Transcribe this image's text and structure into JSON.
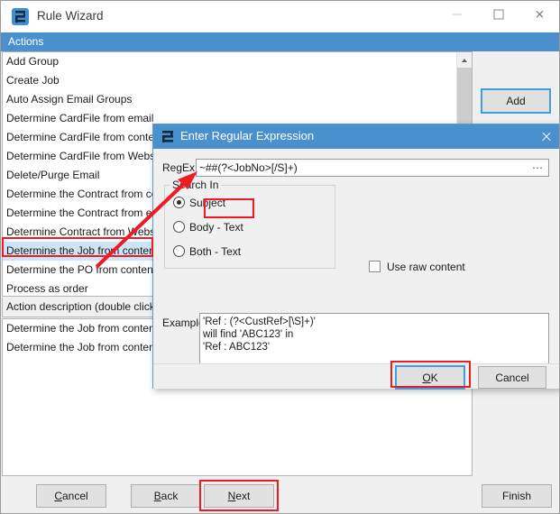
{
  "window": {
    "title": "Rule Wizard",
    "icon": "app-icon",
    "controls": {
      "minimize": "minimize-icon",
      "maximize": "maximize-icon",
      "close": "close-icon"
    }
  },
  "actions_header": {
    "label": "Actions"
  },
  "actions_list": {
    "items": [
      {
        "label": "Add Group",
        "selected": false
      },
      {
        "label": "Create Job",
        "selected": false
      },
      {
        "label": "Auto Assign Email Groups",
        "selected": false
      },
      {
        "label": "Determine CardFile from email",
        "selected": false
      },
      {
        "label": "Determine CardFile from contents",
        "selected": false
      },
      {
        "label": "Determine CardFile from Website",
        "selected": false
      },
      {
        "label": "Delete/Purge Email",
        "selected": false
      },
      {
        "label": "Determine the Contract from contents",
        "selected": false
      },
      {
        "label": "Determine the Contract from email",
        "selected": false
      },
      {
        "label": "Determine Contract from Website",
        "selected": false
      },
      {
        "label": "Determine the Job from contents",
        "selected": true
      },
      {
        "label": "Determine the PO from contents",
        "selected": false
      },
      {
        "label": "Process as order",
        "selected": false
      }
    ]
  },
  "description_section": {
    "header": "Action description (double click to edit)",
    "items": [
      {
        "label": "Determine the Job from contents"
      },
      {
        "label": "Determine the Job from contents"
      }
    ]
  },
  "right_panel": {
    "add_label": "Add"
  },
  "wizard_buttons": {
    "cancel": "Cancel",
    "cancel_accel": "C",
    "back": "Back",
    "back_accel": "B",
    "next": "Next",
    "next_accel": "N",
    "finish": "Finish"
  },
  "dialog": {
    "title": "Enter Regular Expression",
    "icon": "app-icon",
    "close_icon": "close-icon",
    "regex": {
      "label": "RegEx",
      "value": "~##(?<JobNo>[/S]+)",
      "placeholder": "",
      "browse_glyph": "⋯"
    },
    "search_in": {
      "title": "Search In",
      "options": [
        {
          "label": "Subject",
          "checked": true
        },
        {
          "label": "Body - Text",
          "checked": false
        },
        {
          "label": "Both - Text",
          "checked": false
        }
      ]
    },
    "use_raw_content": {
      "label": "Use raw content",
      "checked": false
    },
    "examples": {
      "label": "Examples",
      "text": "'Ref : (?<CustRef>[\\S]+)'\nwill find 'ABC123' in\n'Ref : ABC123'"
    },
    "buttons": {
      "ok": "OK",
      "ok_accel": "O",
      "cancel": "Cancel"
    }
  },
  "annotations": {
    "color": "#ee1c22",
    "boxes": [
      "selected-list-item",
      "subject-radio",
      "ok-button",
      "next-button"
    ],
    "arrow": "points-to-regex-input"
  },
  "colors": {
    "title_bar_accent": "#4a90cf",
    "selection": "#cde5f7",
    "focus_outline": "#3f9fe0",
    "annotation_red": "#ee1c22"
  }
}
